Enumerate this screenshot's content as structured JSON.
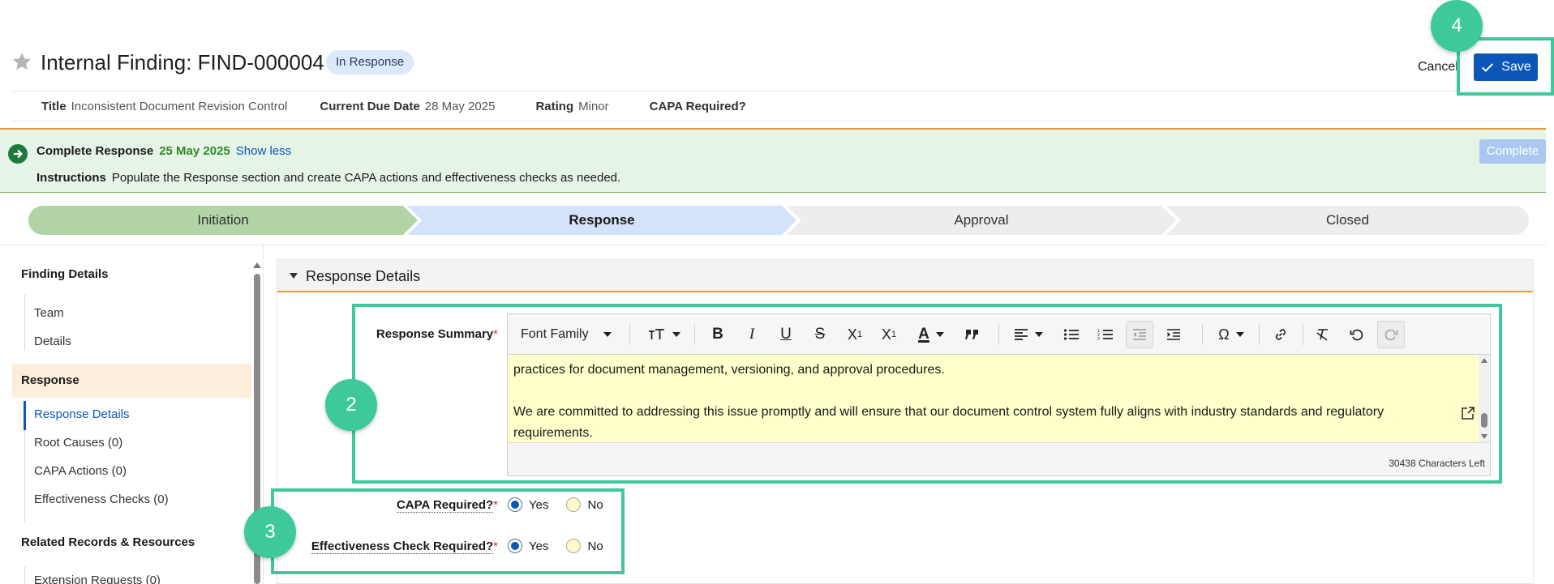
{
  "header": {
    "title": "Internal Finding: FIND-000004",
    "status": "In Response",
    "cancel_label": "Cancel",
    "save_label": "Save"
  },
  "meta": [
    {
      "label": "Title",
      "value": "Inconsistent Document Revision Control"
    },
    {
      "label": "Current Due Date",
      "value": "28 May 2025"
    },
    {
      "label": "Rating",
      "value": "Minor"
    },
    {
      "label": "CAPA Required?",
      "value": ""
    }
  ],
  "banner": {
    "task": "Complete Response",
    "date": "25 May 2025",
    "toggle": "Show less",
    "instructions_label": "Instructions",
    "instructions": "Populate the Response section and create CAPA actions and effectiveness checks as needed.",
    "complete_label": "Complete"
  },
  "stepper": [
    {
      "label": "Initiation",
      "state": "done"
    },
    {
      "label": "Response",
      "state": "current"
    },
    {
      "label": "Approval",
      "state": "pending"
    },
    {
      "label": "Closed",
      "state": "pending"
    }
  ],
  "sidebar": {
    "sections": [
      {
        "title": "Finding Details",
        "items": [
          "Team",
          "Details"
        ]
      },
      {
        "title": "Response",
        "items": [
          "Response Details",
          "Root Causes (0)",
          "CAPA Actions (0)",
          "Effectiveness Checks (0)"
        ]
      },
      {
        "title": "Related Records & Resources",
        "items": [
          "Extension Requests (0)"
        ]
      }
    ],
    "active_item": "Response Details"
  },
  "section": {
    "title": "Response Details"
  },
  "form": {
    "response_summary_label": "Response Summary",
    "required_mark": "*",
    "toolbar": {
      "font_family": "Font Family"
    },
    "editor_text_1": "practices for document management, versioning, and approval procedures.",
    "editor_text_2": "We are committed to addressing this issue promptly and will ensure that our document control system fully aligns with industry standards and regulatory",
    "editor_text_3": "requirements.",
    "char_count": "30438 Characters Left",
    "capa_label": "CAPA Required?",
    "effectiveness_label": "Effectiveness Check Required?",
    "yes": "Yes",
    "no": "No",
    "capa_value": "Yes",
    "effectiveness_value": "Yes"
  },
  "annotations": {
    "step_2": "2",
    "step_3": "3",
    "step_4": "4",
    "color": "#3ec99a"
  },
  "colors": {
    "primary": "#0a57b8",
    "banner_bg": "#e5f4e6",
    "accent_orange": "#e89a3a",
    "step_done": "#b1d5a7",
    "step_current": "#d3e3f8",
    "step_pending": "#ededed",
    "editor_bg": "#ffffcc"
  }
}
